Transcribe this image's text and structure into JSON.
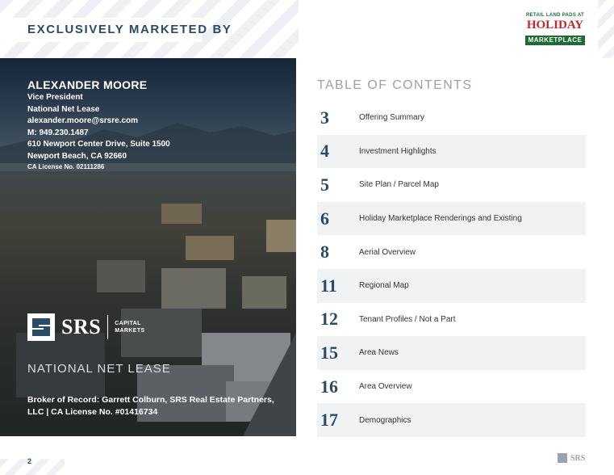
{
  "header": {
    "title": "EXCLUSIVELY MARKETED BY"
  },
  "logo": {
    "top": "RETAIL LAND PADS AT",
    "middle": "HOLIDAY",
    "bottom": "MARKETPLACE"
  },
  "contact": {
    "name": "ALEXANDER MOORE",
    "title": "Vice President",
    "division": "National Net Lease",
    "email": "alexander.moore@srsre.com",
    "phone": "M: 949.230.1487",
    "address1": "610 Newport Center Drive, Suite 1500",
    "address2": "Newport Beach, CA 92660",
    "license": "CA License No. 02111286"
  },
  "srs": {
    "name": "SRS",
    "capital_line1": "CAPITAL",
    "capital_line2": "MARKETS"
  },
  "national_net_lease": "NATIONAL NET LEASE",
  "broker": "Broker of Record: Garrett Colburn, SRS Real Estate Partners, LLC | CA License No. #01416734",
  "toc": {
    "title": "TABLE OF CONTENTS",
    "items": [
      {
        "num": "3",
        "label": "Offering Summary"
      },
      {
        "num": "4",
        "label": "Investment Highlights"
      },
      {
        "num": "5",
        "label": "Site Plan / Parcel Map"
      },
      {
        "num": "6",
        "label": "Holiday Marketplace Renderings and Existing"
      },
      {
        "num": "8",
        "label": "Aerial Overview"
      },
      {
        "num": "11",
        "label": "Regional Map"
      },
      {
        "num": "12",
        "label": "Tenant Profiles / Not a Part"
      },
      {
        "num": "15",
        "label": "Area News"
      },
      {
        "num": "16",
        "label": "Area Overview"
      },
      {
        "num": "17",
        "label": "Demographics"
      }
    ]
  },
  "footer": {
    "page": "2",
    "brand": "SRS"
  },
  "colors": {
    "navy": "#2a4a6a",
    "gray": "#9aa2aa",
    "row_shade": "#f1f2f4"
  }
}
